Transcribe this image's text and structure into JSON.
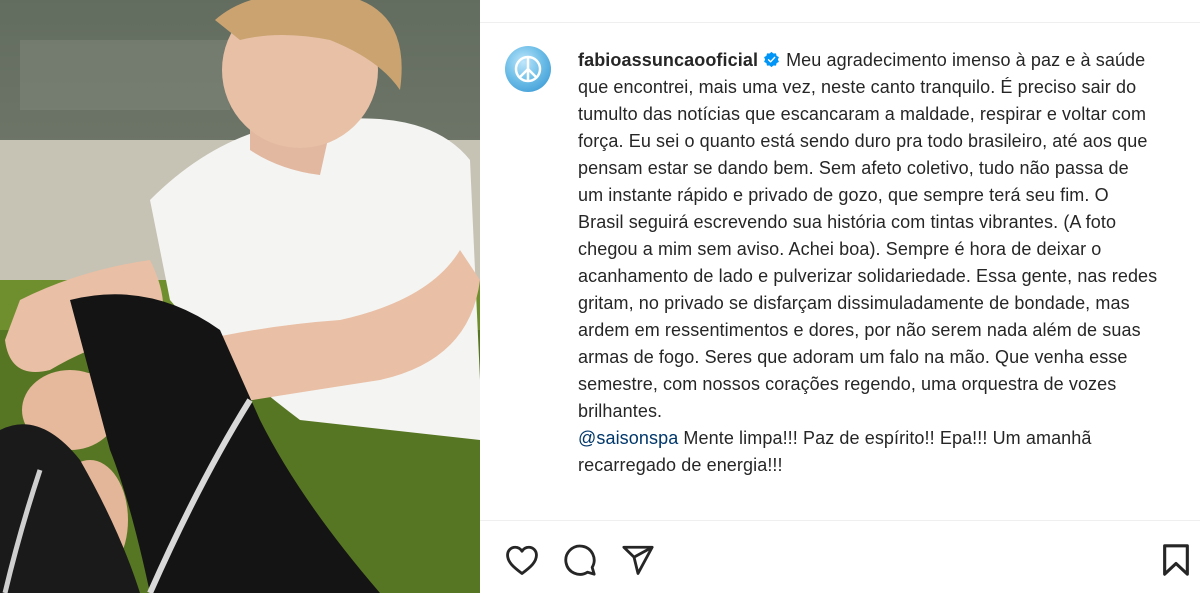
{
  "post": {
    "username": "fabioassuncaooficial",
    "caption": "Meu agradecimento imenso à paz e à saúde que encontrei, mais uma vez, neste canto tranquilo. É preciso sair do tumulto das notícias que escancaram a maldade, respirar e voltar com força. Eu sei o quanto está sendo duro pra todo brasileiro, até aos que pensam estar se dando bem. Sem afeto coletivo, tudo não passa de um instante rápido e privado de gozo, que sempre terá seu fim. O Brasil seguirá escrevendo sua história com tintas vibrantes. (A foto chegou a mim sem aviso. Achei boa). Sempre é hora de deixar o acanhamento de lado e pulverizar solidariedade. Essa gente, nas redes gritam, no privado se disfarçam dissimuladamente de bondade, mas ardem em ressentimentos e dores, por não serem nada além de suas armas de fogo. Seres que adoram um falo na mão. Que venha esse semestre, com nossos corações regendo, uma orquestra de vozes brilhantes.",
    "mention": "@saisonspa",
    "mention_text": " Mente limpa!!! Paz de espírito!! Epa!!! Um amanhã recarregado de energia!!!"
  },
  "icons": {
    "verified": "verified-badge-icon",
    "like": "heart-icon",
    "comment": "comment-icon",
    "share": "paper-plane-icon",
    "save": "bookmark-icon",
    "avatar": "peace-symbol-icon"
  },
  "colors": {
    "text": "#262626",
    "mention": "#00376b",
    "verified": "#0095f6",
    "divider": "#efefef"
  }
}
